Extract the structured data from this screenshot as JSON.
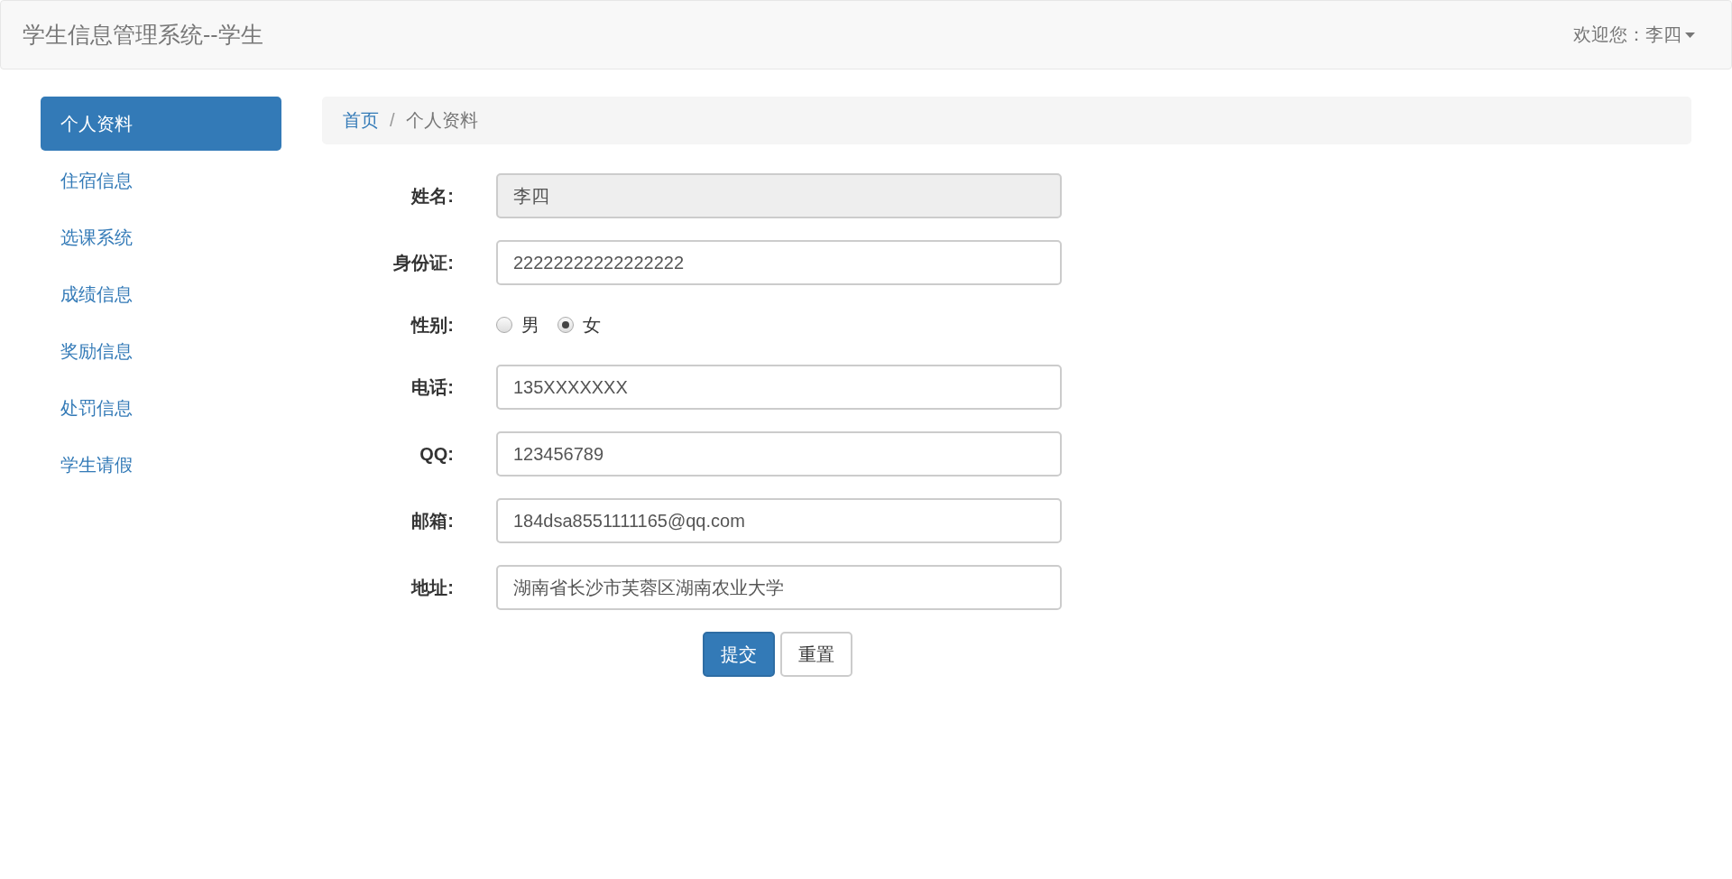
{
  "navbar": {
    "title": "学生信息管理系统--学生",
    "user_menu": "欢迎您：李四"
  },
  "sidebar": {
    "items": [
      {
        "label": "个人资料",
        "selected": true
      },
      {
        "label": "住宿信息",
        "selected": false
      },
      {
        "label": "选课系统",
        "selected": false
      },
      {
        "label": "成绩信息",
        "selected": false
      },
      {
        "label": "奖励信息",
        "selected": false
      },
      {
        "label": "处罚信息",
        "selected": false
      },
      {
        "label": "学生请假",
        "selected": false
      }
    ]
  },
  "breadcrumb_separator": "/",
  "breadcrumb": [
    {
      "label": "首页",
      "kind": "link"
    },
    {
      "label": "个人资料",
      "kind": "current"
    }
  ],
  "form": {
    "fields": [
      {
        "kind": "text",
        "label": "姓名:",
        "value": "李四",
        "disabled": true
      },
      {
        "kind": "text",
        "label": "身份证:",
        "value": "22222222222222222",
        "disabled": false
      },
      {
        "kind": "radio",
        "label": "性别:",
        "options": [
          {
            "label": "男",
            "selected": false
          },
          {
            "label": "女",
            "selected": true
          }
        ]
      },
      {
        "kind": "text",
        "label": "电话:",
        "value": "135XXXXXXX",
        "disabled": false
      },
      {
        "kind": "text",
        "label": "QQ:",
        "value": "123456789",
        "disabled": false
      },
      {
        "kind": "text",
        "label": "邮箱:",
        "value": "184dsa8551111165@qq.com",
        "disabled": false
      },
      {
        "kind": "text",
        "label": "地址:",
        "value": "湖南省长沙市芙蓉区湖南农业大学",
        "disabled": false
      }
    ],
    "buttons": [
      {
        "label": "提交",
        "kind": "primary"
      },
      {
        "label": "重置",
        "kind": "default"
      }
    ]
  }
}
